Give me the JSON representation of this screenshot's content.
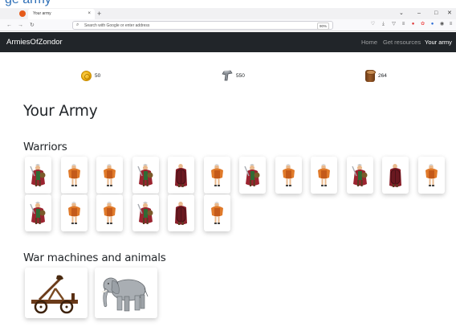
{
  "browser": {
    "tab_title": "Your army",
    "tab_close": "×",
    "new_tab": "+",
    "url_lock": "🔒",
    "url_text": "Search with Google or enter address",
    "zoom": "90%",
    "window_controls": [
      "⌄",
      "–",
      "□",
      "✕"
    ]
  },
  "navbar": {
    "brand": "ArmiesOfZondor",
    "links": [
      {
        "label": "Home",
        "active": false
      },
      {
        "label": "Get resources",
        "active": false
      },
      {
        "label": "Your army",
        "active": true
      }
    ]
  },
  "resources": {
    "gold": "50",
    "iron": "550",
    "wood": "264"
  },
  "page_title": "Your Army",
  "sections": {
    "warriors": "Warriors",
    "machines": "War machines and animals"
  },
  "warriors": [
    "swordsman",
    "archer",
    "archer",
    "swordsman",
    "shieldbearer",
    "archer",
    "swordsman",
    "archer",
    "archer",
    "swordsman",
    "shieldbearer",
    "archer",
    "swordsman",
    "archer",
    "archer",
    "swordsman",
    "shieldbearer",
    "archer"
  ],
  "machines": [
    "catapult",
    "elephant"
  ],
  "colors": {
    "navbar_bg": "#212529",
    "cloak_red": "#9b2430",
    "armor_orange": "#e07a2a"
  }
}
